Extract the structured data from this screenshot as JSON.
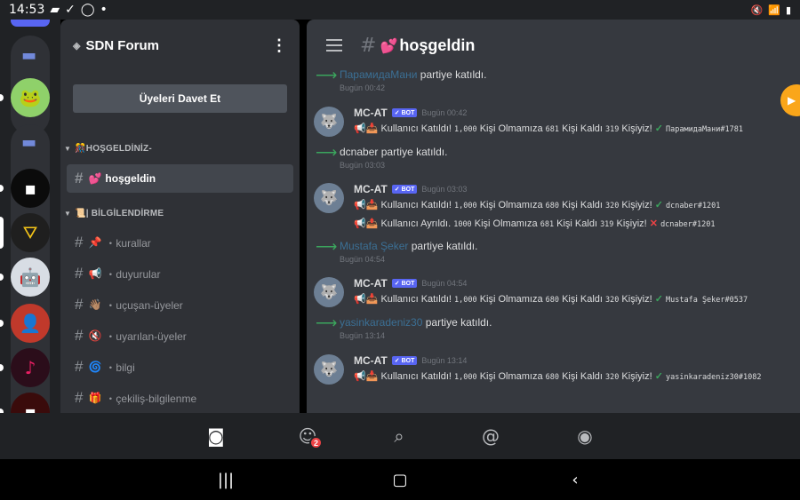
{
  "status_bar": {
    "time": "14:53",
    "icons_left": [
      "video-icon",
      "check-icon",
      "whatsapp-icon",
      "dot-icon"
    ],
    "icons_right": [
      "mute-icon",
      "wifi-icon",
      "battery-icon"
    ]
  },
  "server": {
    "name": "SDN Forum",
    "invite_label": "Üyeleri Davet Et"
  },
  "categories": [
    {
      "label": "HOŞGELDİNİZ-",
      "emoji": "🎊"
    },
    {
      "label": "| BİLGİLENDİRME",
      "emoji": "📜"
    }
  ],
  "channels_welcome": [
    {
      "emoji": "💕",
      "name": "hoşgeldin",
      "active": true
    }
  ],
  "channels_info": [
    {
      "emoji": "📌",
      "name": "・kurallar"
    },
    {
      "emoji": "📢",
      "name": "・duyurular"
    },
    {
      "emoji": "👋🏽",
      "name": "・uçuşan-üyeler"
    },
    {
      "emoji": "🔇",
      "name": "・uyarılan-üyeler"
    },
    {
      "emoji": "🌀",
      "name": "・bilgi"
    },
    {
      "emoji": "🎁",
      "name": "・çekiliş-bilgilenme"
    }
  ],
  "main": {
    "channel_emoji": "💕",
    "channel_name": "hoşgeldin"
  },
  "messages": {
    "m1": {
      "user": "ПарамидаМани",
      "text": "partiye katıldı.",
      "time": "Bugün 00:42"
    },
    "m2": {
      "bot": "MC-AT",
      "tag": "BOT",
      "time": "Bugün 00:42",
      "line1": {
        "a": "Kullanıcı Katıldı!",
        "n1": "1,000",
        "b": "Kişi Olmamıza",
        "n2": "681",
        "c": "Kişi Kaldı",
        "n3": "319",
        "d": "Kişiyiz!",
        "user": "ПарамидаМани#1781"
      }
    },
    "m3": {
      "user": "dcnaber",
      "text": "partiye katıldı.",
      "time": "Bugün 03:03"
    },
    "m4": {
      "bot": "MC-AT",
      "tag": "BOT",
      "time": "Bugün 03:03",
      "line1": {
        "a": "Kullanıcı Katıldı!",
        "n1": "1,000",
        "b": "Kişi Olmamıza",
        "n2": "680",
        "c": "Kişi Kaldı",
        "n3": "320",
        "d": "Kişiyiz!",
        "user": "dcnaber#1201"
      },
      "line2": {
        "a": "Kullanıcı Ayrıldı.",
        "n1": "1000",
        "b": "Kişi Olmamıza",
        "n2": "681",
        "c": "Kişi Kaldı",
        "n3": "319",
        "d": "Kişiyiz!",
        "user": "dcnaber#1201"
      }
    },
    "m5": {
      "user": "Mustafa Şeker",
      "text": "partiye katıldı.",
      "time": "Bugün 04:54"
    },
    "m6": {
      "bot": "MC-AT",
      "tag": "BOT",
      "time": "Bugün 04:54",
      "line1": {
        "a": "Kullanıcı Katıldı!",
        "n1": "1,000",
        "b": "Kişi Olmamıza",
        "n2": "680",
        "c": "Kişi Kaldı",
        "n3": "320",
        "d": "Kişiyiz!",
        "user": "Mustafa Şeker#0537"
      }
    },
    "m7": {
      "user": "yasinkaradeniz30",
      "text": "partiye katıldı.",
      "time": "Bugün 13:14"
    },
    "m8": {
      "bot": "MC-AT",
      "tag": "BOT",
      "time": "Bugün 13:14",
      "line1": {
        "a": "Kullanıcı Katıldı!",
        "n1": "1,000",
        "b": "Kişi Olmamıza",
        "n2": "680",
        "c": "Kişi Kaldı",
        "n3": "320",
        "d": "Kişiyiz!",
        "user": "yasinkaradeniz30#1082"
      }
    }
  },
  "bottom_nav": {
    "friends_badge": "2"
  },
  "colors": {
    "accent": "#5865f2",
    "join_green": "#3ba55d",
    "danger": "#ed4245",
    "call": "#faa61a"
  }
}
